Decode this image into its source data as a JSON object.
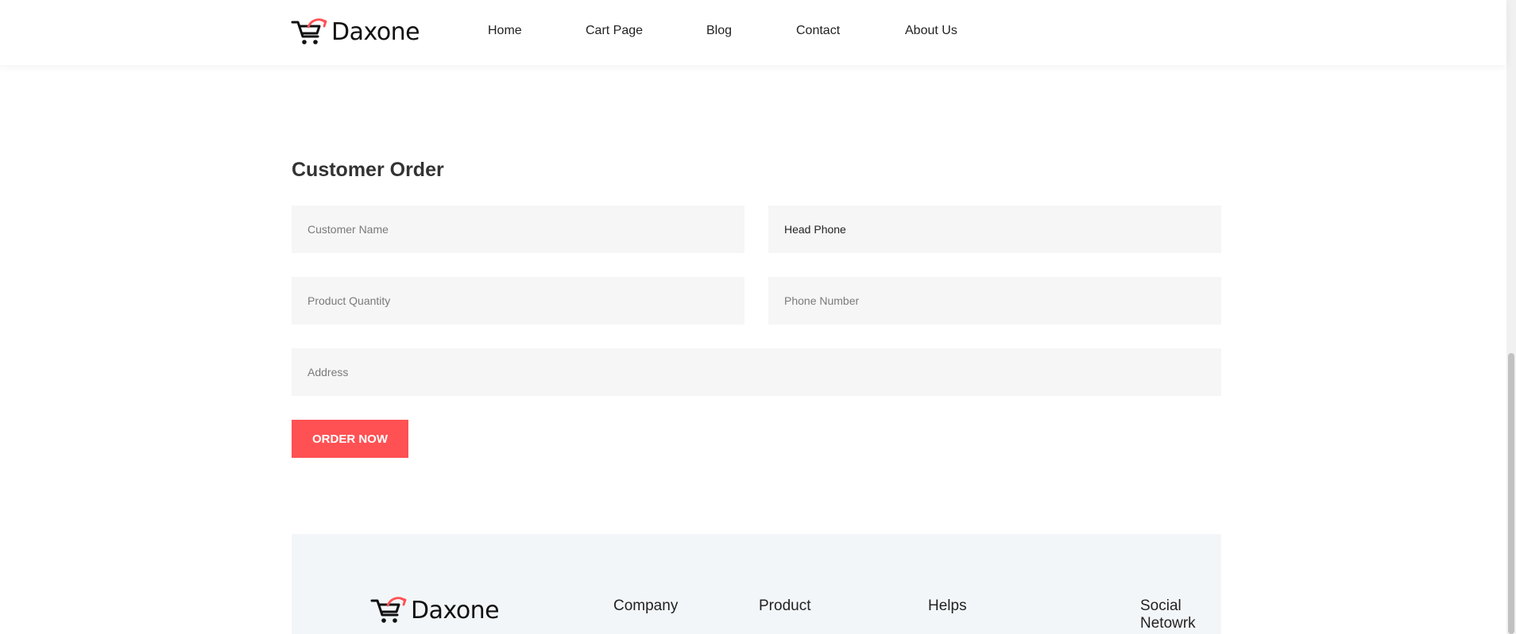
{
  "brand": {
    "name": "Daxone",
    "accent_color": "#ff5153",
    "logo_icon": "cart-logo-icon"
  },
  "nav": {
    "items": [
      {
        "label": "Home"
      },
      {
        "label": "Cart Page"
      },
      {
        "label": "Blog"
      },
      {
        "label": "Contact"
      },
      {
        "label": "About Us"
      }
    ]
  },
  "form": {
    "title": "Customer Order",
    "customer_name": {
      "placeholder": "Customer Name",
      "value": ""
    },
    "product": {
      "placeholder": "",
      "value": "Head Phone"
    },
    "quantity": {
      "placeholder": "Product Quantity",
      "value": ""
    },
    "phone": {
      "placeholder": "Phone Number",
      "value": ""
    },
    "address": {
      "placeholder": "Address",
      "value": ""
    },
    "submit_label": "ORDER NOW"
  },
  "footer": {
    "brand": "Daxone",
    "columns": [
      {
        "heading": "Company"
      },
      {
        "heading": "Product"
      },
      {
        "heading": "Helps"
      },
      {
        "heading": "Social Netowrk"
      }
    ]
  }
}
